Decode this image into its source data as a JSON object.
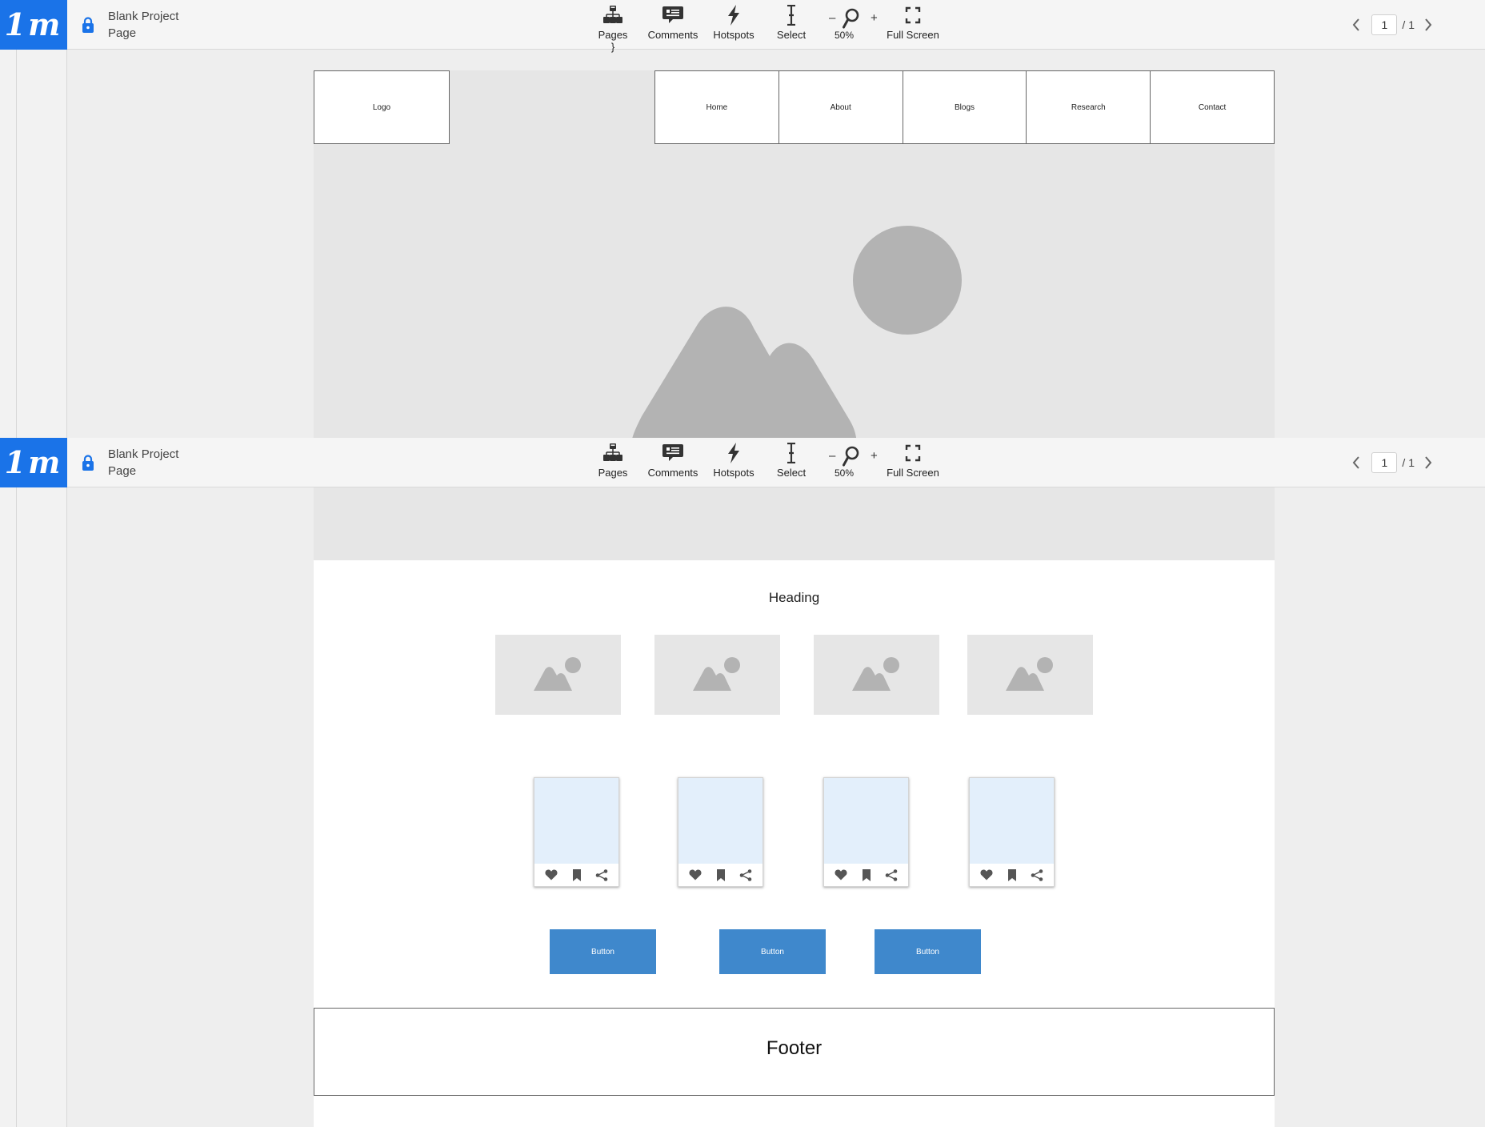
{
  "app": {
    "brand_mark": "1m",
    "project_name": "Blank Project",
    "page_name": "Page"
  },
  "toolbar": {
    "pages_label": "Pages",
    "comments_label": "Comments",
    "hotspots_label": "Hotspots",
    "select_label": "Select",
    "zoom_minus": "–",
    "zoom_plus": "+",
    "zoom_level": "50%",
    "fullscreen_label": "Full Screen"
  },
  "pager": {
    "current_page": "1",
    "total": "/ 1"
  },
  "wireframe": {
    "logo_label": "Logo",
    "nav_items": [
      "Home",
      "About",
      "Blogs",
      "Research",
      "Contact"
    ],
    "heading": "Heading",
    "thumbnail_count": 4,
    "card_count": 4,
    "card_actions": [
      "heart-icon",
      "bookmark-icon",
      "share-icon"
    ],
    "buttons": [
      "Button",
      "Button",
      "Button"
    ],
    "footer": "Footer"
  },
  "colors": {
    "brand_blue": "#1a73e8",
    "button_blue": "#3f88cc",
    "card_image_bg": "#e3effb",
    "placeholder_bg": "#e6e6e6",
    "placeholder_shape": "#b3b3b3"
  }
}
